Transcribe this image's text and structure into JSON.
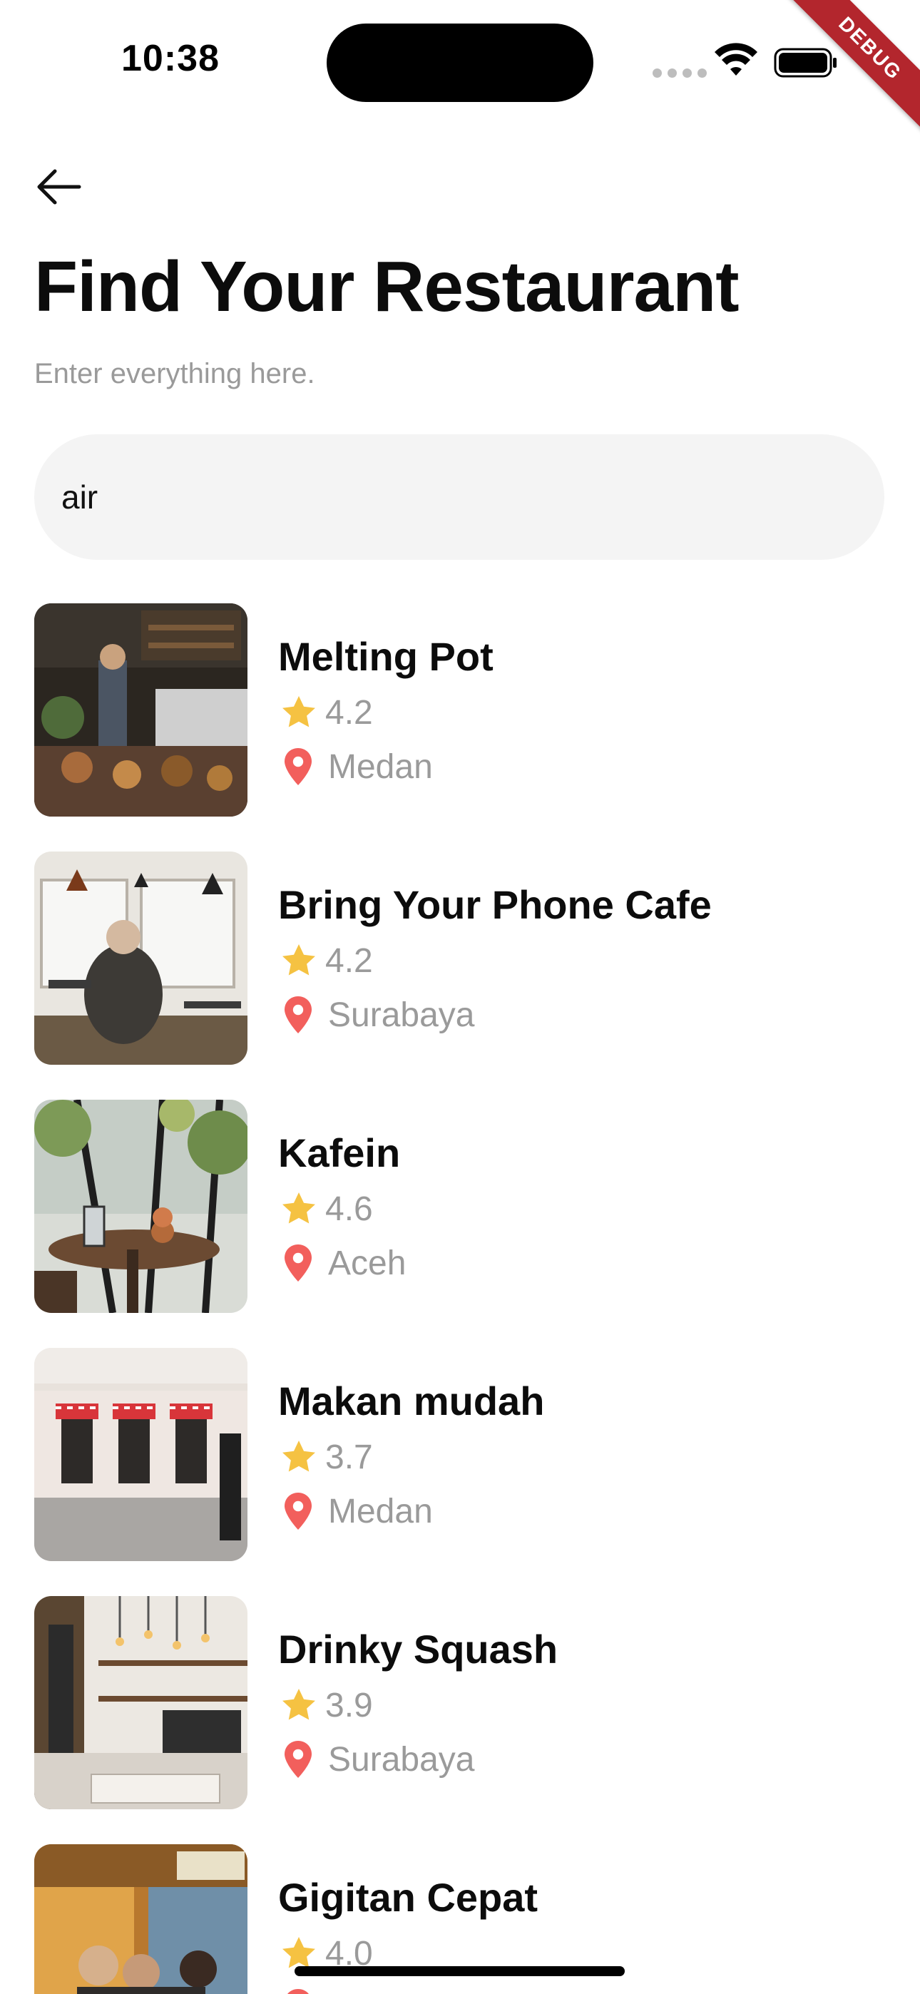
{
  "status_bar": {
    "time": "10:38",
    "debug_label": "DEBUG"
  },
  "header": {
    "back_icon": "arrow-left-icon",
    "title": "Find Your Restaurant",
    "subtitle": "Enter everything here."
  },
  "search": {
    "value": "air",
    "placeholder": ""
  },
  "colors": {
    "star": "#F5C242",
    "pin": "#F25F5C",
    "search_bg": "#F4F4F4",
    "muted_text": "#9A9A9A",
    "debug_ribbon": "#B3262D"
  },
  "restaurants": [
    {
      "name": "Melting Pot",
      "rating": "4.2",
      "city": "Medan"
    },
    {
      "name": "Bring Your Phone Cafe",
      "rating": "4.2",
      "city": "Surabaya"
    },
    {
      "name": "Kafein",
      "rating": "4.6",
      "city": "Aceh"
    },
    {
      "name": "Makan mudah",
      "rating": "3.7",
      "city": "Medan"
    },
    {
      "name": "Drinky Squash",
      "rating": "3.9",
      "city": "Surabaya"
    },
    {
      "name": "Gigitan Cepat",
      "rating": "4.0",
      "city": ""
    }
  ]
}
